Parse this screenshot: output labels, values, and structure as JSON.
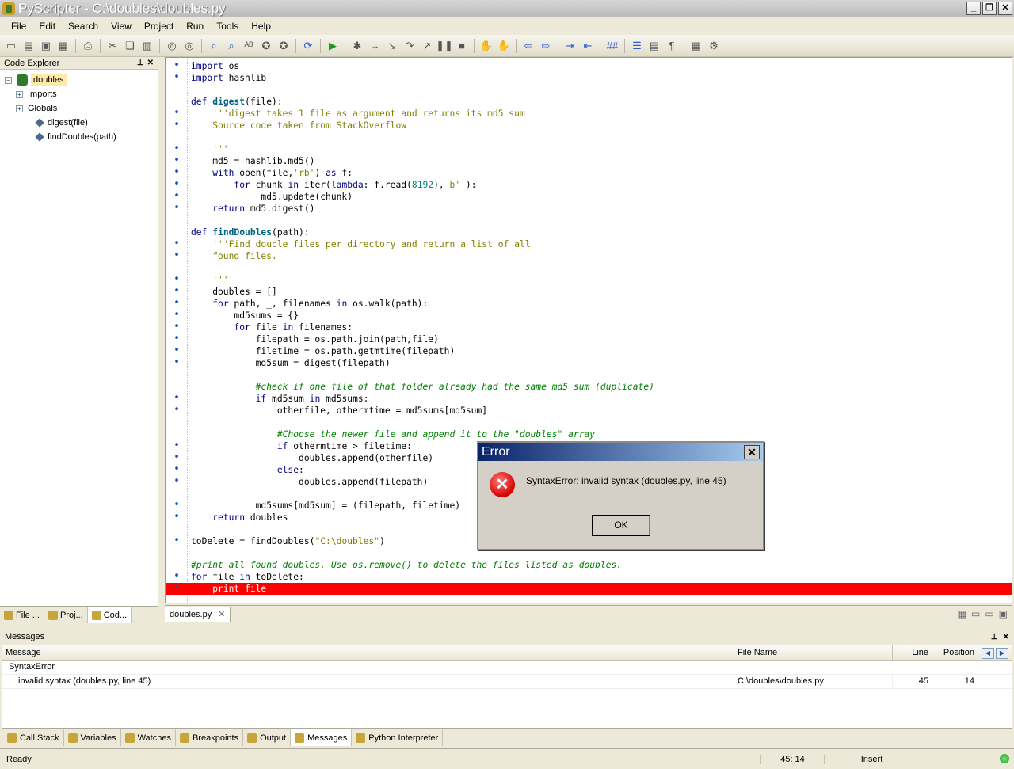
{
  "window": {
    "title": "PyScripter - C:\\doubles\\doubles.py"
  },
  "menu": [
    "File",
    "Edit",
    "Search",
    "View",
    "Project",
    "Run",
    "Tools",
    "Help"
  ],
  "code_explorer": {
    "title": "Code Explorer",
    "root": "doubles",
    "nodes": [
      "Imports",
      "Globals",
      "digest(file)",
      "findDoubles(path)"
    ]
  },
  "left_tabs": [
    "File ...",
    "Proj...",
    "Cod..."
  ],
  "editor": {
    "tab": "doubles.py",
    "lines": [
      {
        "dot": true,
        "html": "<span class='kw'>import</span> os"
      },
      {
        "dot": true,
        "html": "<span class='kw'>import</span> hashlib"
      },
      {
        "dot": false,
        "html": ""
      },
      {
        "dot": false,
        "html": "<span class='kw'>def</span> <span class='fn'>digest</span>(file):"
      },
      {
        "dot": true,
        "html": "    <span class='str'>'''digest takes 1 file as argument and returns its md5 sum</span>"
      },
      {
        "dot": true,
        "html": "<span class='str'>    Source code taken from StackOverflow</span>"
      },
      {
        "dot": false,
        "html": ""
      },
      {
        "dot": true,
        "html": "<span class='str'>    '''</span>"
      },
      {
        "dot": true,
        "html": "    md5 = hashlib.md5()"
      },
      {
        "dot": true,
        "html": "    <span class='kw'>with</span> open(file,<span class='str'>'rb'</span>) <span class='kw'>as</span> f:"
      },
      {
        "dot": true,
        "html": "        <span class='kw'>for</span> chunk <span class='kw'>in</span> iter(<span class='kw'>lambda</span>: f.read(<span class='num'>8192</span>), <span class='str'>b''</span>):"
      },
      {
        "dot": true,
        "html": "             md5.update(chunk)"
      },
      {
        "dot": true,
        "html": "    <span class='kw'>return</span> md5.digest()"
      },
      {
        "dot": false,
        "html": ""
      },
      {
        "dot": false,
        "html": "<span class='kw'>def</span> <span class='fn'>findDoubles</span>(path):"
      },
      {
        "dot": true,
        "html": "    <span class='str'>'''Find double files per directory and return a list of all</span>"
      },
      {
        "dot": true,
        "html": "<span class='str'>    found files.</span>"
      },
      {
        "dot": false,
        "html": ""
      },
      {
        "dot": true,
        "html": "<span class='str'>    '''</span>"
      },
      {
        "dot": true,
        "html": "    doubles = []"
      },
      {
        "dot": true,
        "html": "    <span class='kw'>for</span> path, _, filenames <span class='kw'>in</span> os.walk(path):"
      },
      {
        "dot": true,
        "html": "        md5sums = {}"
      },
      {
        "dot": true,
        "html": "        <span class='kw'>for</span> file <span class='kw'>in</span> filenames:"
      },
      {
        "dot": true,
        "html": "            filepath = os.path.join(path,file)"
      },
      {
        "dot": true,
        "html": "            filetime = os.path.getmtime(filepath)"
      },
      {
        "dot": true,
        "html": "            md5sum = digest(filepath)"
      },
      {
        "dot": false,
        "html": ""
      },
      {
        "dot": false,
        "html": "            <span class='cmt'>#check if one file of that folder already had the same md5 sum (duplicate)</span>"
      },
      {
        "dot": true,
        "html": "            <span class='kw'>if</span> md5sum <span class='kw'>in</span> md5sums:"
      },
      {
        "dot": true,
        "html": "                otherfile, othermtime = md5sums[md5sum]"
      },
      {
        "dot": false,
        "html": ""
      },
      {
        "dot": false,
        "html": "                <span class='cmt'>#Choose the newer file and append it to the \"doubles\" array</span>"
      },
      {
        "dot": true,
        "html": "                <span class='kw'>if</span> othermtime > filetime:"
      },
      {
        "dot": true,
        "html": "                    doubles.append(otherfile)"
      },
      {
        "dot": true,
        "html": "                <span class='kw'>else</span>:"
      },
      {
        "dot": true,
        "html": "                    doubles.append(filepath)"
      },
      {
        "dot": false,
        "html": ""
      },
      {
        "dot": true,
        "html": "            md5sums[md5sum] = (filepath, filetime)"
      },
      {
        "dot": true,
        "html": "    <span class='kw'>return</span> doubles"
      },
      {
        "dot": false,
        "html": ""
      },
      {
        "dot": true,
        "html": "toDelete = findDoubles(<span class='str'>\"C:\\doubles\"</span>)"
      },
      {
        "dot": false,
        "html": ""
      },
      {
        "dot": false,
        "html": "<span class='cmt'>#print all found doubles. Use os.remove() to delete the files listed as doubles.</span>"
      },
      {
        "dot": true,
        "html": "<span class='kw'>for</span> file <span class='kw'>in</span> toDelete:"
      },
      {
        "dot": true,
        "html": "    print file",
        "error": true
      }
    ]
  },
  "messages": {
    "title": "Messages",
    "columns": {
      "message": "Message",
      "file": "File Name",
      "line": "Line",
      "position": "Position"
    },
    "group": "SyntaxError",
    "row": {
      "message": "invalid syntax (doubles.py, line 45)",
      "file": "C:\\doubles\\doubles.py",
      "line": "45",
      "position": "14"
    }
  },
  "bottom_tabs": [
    "Call Stack",
    "Variables",
    "Watches",
    "Breakpoints",
    "Output",
    "Messages",
    "Python Interpreter"
  ],
  "status": {
    "state": "Ready",
    "cursor": "45: 14",
    "mode": "Insert"
  },
  "dialog": {
    "title": "Error",
    "message": "SyntaxError: invalid syntax (doubles.py, line 45)",
    "ok": "OK"
  }
}
